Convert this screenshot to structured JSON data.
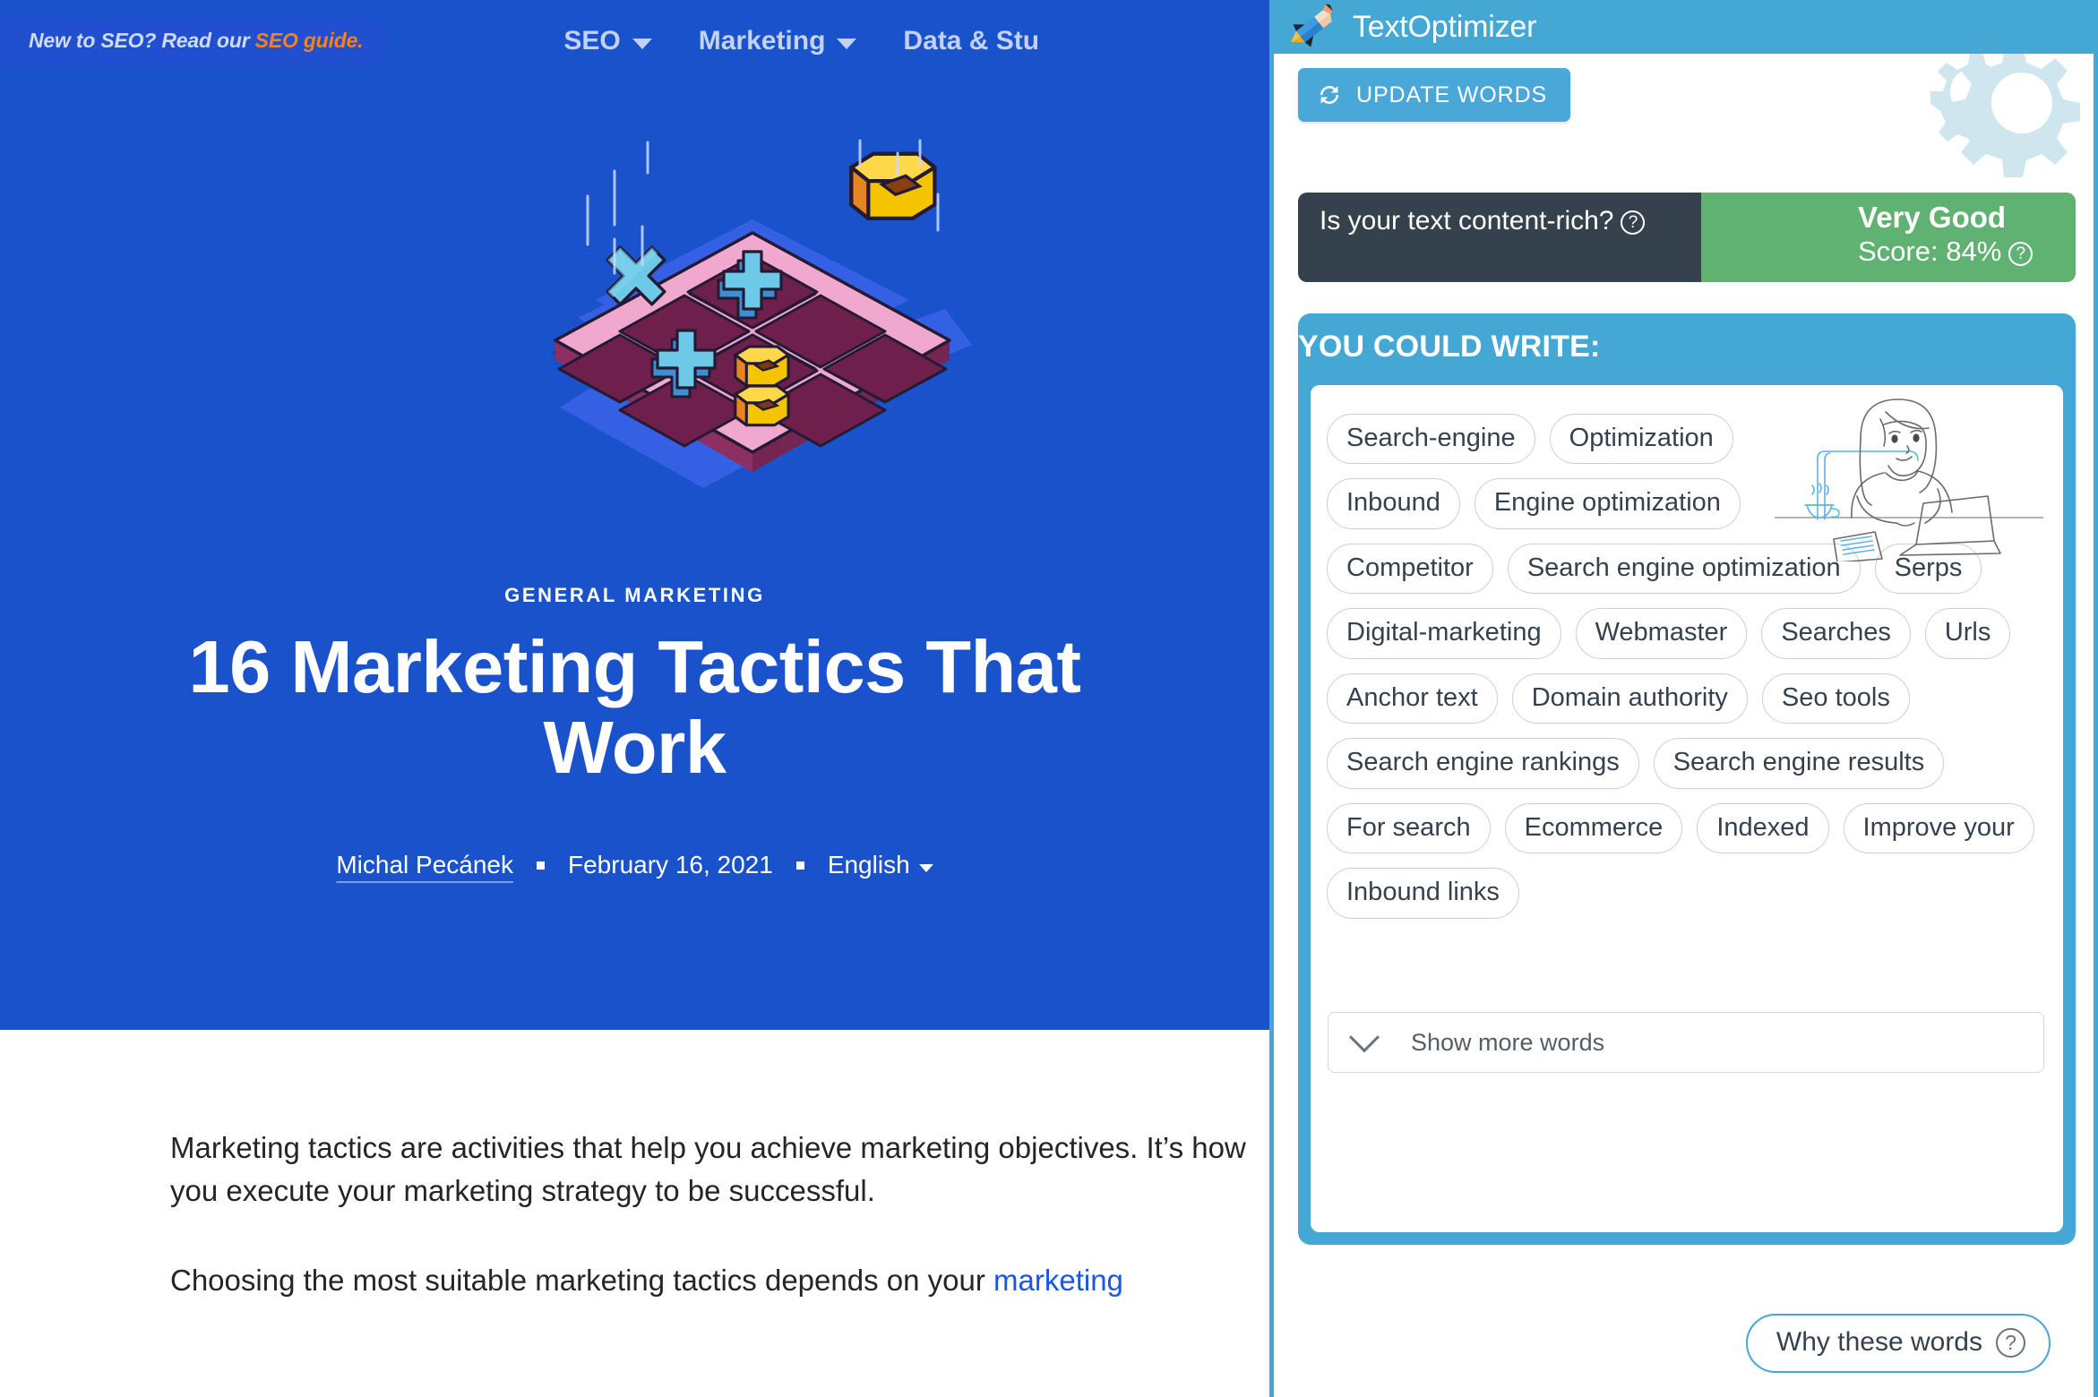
{
  "blog": {
    "nav": {
      "badge_prefix": "New to SEO? Read our ",
      "badge_link": "SEO guide.",
      "links": [
        {
          "label": "SEO",
          "has_caret": true
        },
        {
          "label": "Marketing",
          "has_caret": true
        },
        {
          "label": "Data & Stu",
          "has_caret": false
        }
      ]
    },
    "hero": {
      "category": "GENERAL MARKETING",
      "title": "16 Marketing Tactics That Work",
      "author": "Michal Pecánek",
      "date": "February 16, 2021",
      "language": "English",
      "background_color": "#1A52CC"
    },
    "article": {
      "paragraph1": "Marketing tactics are activities that help you achieve marketing objectives. It’s how you execute your marketing strategy to be successful.",
      "paragraph2_before_link": "Choosing the most suitable marketing tactics depends on your ",
      "paragraph2_link": "marketing"
    }
  },
  "textoptimizer": {
    "header": {
      "app_title": "TextOptimizer",
      "logo_icon": "pencil-rocket-icon",
      "bar_color": "#45A8D4"
    },
    "update_button": {
      "label": "UPDATE WORDS",
      "icon": "refresh-icon"
    },
    "score": {
      "question": "Is your text content-rich?",
      "question_help_icon": "question-mark-icon",
      "rating_label": "Very Good",
      "score_label": "Score: 84%",
      "score_percent": 84,
      "score_help_icon": "question-mark-icon",
      "avatar_icon": "robot-avatar-icon",
      "question_bg_color": "#36414E",
      "score_bg_color": "#5FB271"
    },
    "suggestions": {
      "heading": "YOU COULD WRITE:",
      "illustration_icon": "woman-at-laptop-icon",
      "words": [
        "Search-engine",
        "Optimization",
        "Inbound",
        "Engine optimization",
        "Competitor",
        "Search engine optimization",
        "Serps",
        "Digital-marketing",
        "Webmaster",
        "Searches",
        "Urls",
        "Anchor text",
        "Domain authority",
        "Seo tools",
        "Search engine rankings",
        "Search engine results",
        "For search",
        "Ecommerce",
        "Indexed",
        "Improve your",
        "Inbound links"
      ],
      "show_more_label": "Show more words",
      "show_more_icon": "chevron-down-icon",
      "why_words_label": "Why these words",
      "why_words_icon": "question-mark-icon"
    }
  }
}
